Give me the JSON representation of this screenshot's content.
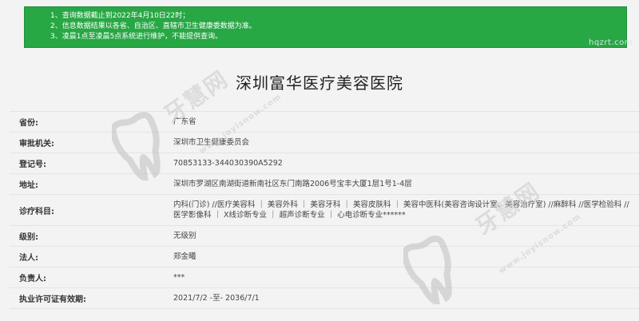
{
  "notice": {
    "lines": [
      "1、查询数据截止到2022年4月10日22时；",
      "2、信息数据结果以各省、自治区、直辖市卫生健康委数据为准。",
      "3、凌晨1点至凌晨5点系统进行维护，不能提供查询。"
    ]
  },
  "watermark": {
    "top_url": "hqzrt.com",
    "brand": "牙慧网",
    "url": "www.joyisnow.com"
  },
  "page_title": "深圳富华医疗美容医院",
  "rows": [
    {
      "label": "省份:",
      "value": "广东省"
    },
    {
      "label": "审批机关:",
      "value": "深圳市卫生健康委员会"
    },
    {
      "label": "登记号:",
      "value": "70853133-344030390A5292"
    },
    {
      "label": "地址:",
      "value": "深圳市罗湖区南湖街道新南社区东门南路2006号宝丰大厦1层1号1-4层"
    },
    {
      "label": "诊疗科目:",
      "value": "内科(门诊) //医疗美容科 ｜ 美容外科 ｜ 美容牙科 ｜ 美容皮肤科 ｜ 美容中医科(美容咨询设计室、美容治疗室) //麻醉科 //医学检验科 //医学影像科 ｜ X线诊断专业 ｜ 超声诊断专业 ｜ 心电诊断专业******"
    },
    {
      "label": "级别:",
      "value": "无级别"
    },
    {
      "label": "法人:",
      "value": "郑金曦"
    },
    {
      "label": "负责人:",
      "value": "***"
    },
    {
      "label": "执业许可证有效期:",
      "value": "2021/7/2 -至- 2036/7/1"
    }
  ]
}
